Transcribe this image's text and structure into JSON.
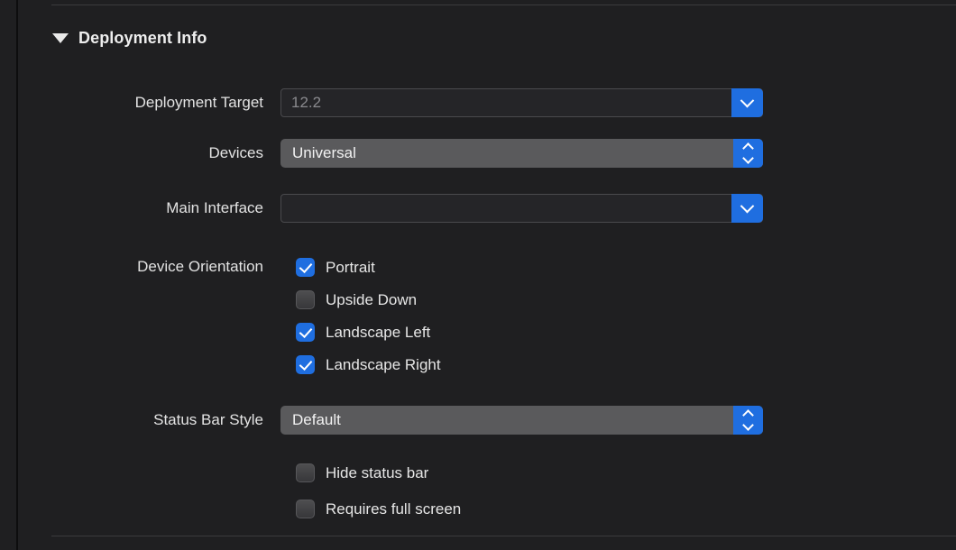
{
  "panel": {
    "section_title": "Deployment Info",
    "disclosure_state": "expanded",
    "disclosure_icon": "triangle-down-icon"
  },
  "fields": {
    "deployment_target": {
      "label": "Deployment Target",
      "value": "12.2",
      "control": "combo-box",
      "button_icon": "chevron-down-icon"
    },
    "devices": {
      "label": "Devices",
      "value": "Universal",
      "control": "popup-button",
      "button_icon": "chevron-up-down-icon"
    },
    "main_interface": {
      "label": "Main Interface",
      "value": "",
      "control": "combo-box",
      "button_icon": "chevron-down-icon"
    },
    "status_bar_style": {
      "label": "Status Bar Style",
      "value": "Default",
      "control": "popup-button",
      "button_icon": "chevron-up-down-icon"
    }
  },
  "device_orientation": {
    "label": "Device Orientation",
    "options": [
      {
        "label": "Portrait",
        "checked": true
      },
      {
        "label": "Upside Down",
        "checked": false
      },
      {
        "label": "Landscape Left",
        "checked": true
      },
      {
        "label": "Landscape Right",
        "checked": true
      }
    ]
  },
  "status_bar_options": [
    {
      "label": "Hide status bar",
      "checked": false
    },
    {
      "label": "Requires full screen",
      "checked": false
    }
  ],
  "colors": {
    "background": "#1f1f21",
    "accent_blue": "#1f6ee0",
    "popup_fill": "#5a5a5c",
    "combo_fill": "#252528",
    "text": "#e8e8e8",
    "text_dim": "#8a8a8e",
    "separator": "#3b3b3d"
  }
}
